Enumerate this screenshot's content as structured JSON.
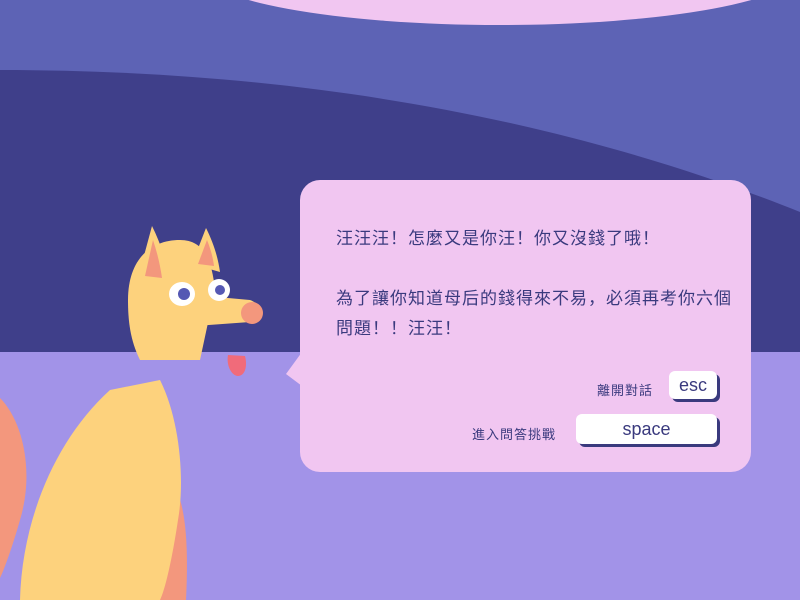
{
  "dialog": {
    "line1": "汪汪汪！怎麼又是你汪！你又沒錢了哦！",
    "line2": "為了讓你知道母后的錢得來不易，必須再考你六個問題！！汪汪！"
  },
  "options": {
    "leave_label": "離開對話",
    "leave_key": "esc",
    "challenge_label": "進入問答挑戰",
    "challenge_key": "space"
  },
  "colors": {
    "sky_top": "#5d63b5",
    "wall": "#3f3f8a",
    "floor": "#a293e8",
    "cloud": "#f1c6f1",
    "dialog_bg": "#f1c6f1",
    "text": "#3a3a7e",
    "dog_body": "#fdd27d",
    "dog_accent": "#f3977d"
  }
}
